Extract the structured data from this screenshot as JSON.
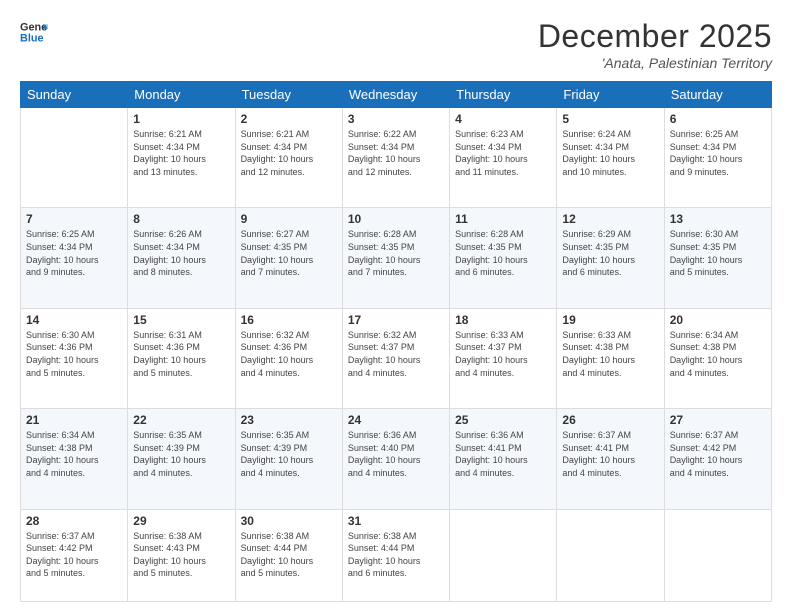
{
  "logo": {
    "line1": "General",
    "line2": "Blue"
  },
  "title": "December 2025",
  "subtitle": "'Anata, Palestinian Territory",
  "days_of_week": [
    "Sunday",
    "Monday",
    "Tuesday",
    "Wednesday",
    "Thursday",
    "Friday",
    "Saturday"
  ],
  "weeks": [
    [
      {
        "num": "",
        "info": ""
      },
      {
        "num": "1",
        "info": "Sunrise: 6:21 AM\nSunset: 4:34 PM\nDaylight: 10 hours\nand 13 minutes."
      },
      {
        "num": "2",
        "info": "Sunrise: 6:21 AM\nSunset: 4:34 PM\nDaylight: 10 hours\nand 12 minutes."
      },
      {
        "num": "3",
        "info": "Sunrise: 6:22 AM\nSunset: 4:34 PM\nDaylight: 10 hours\nand 12 minutes."
      },
      {
        "num": "4",
        "info": "Sunrise: 6:23 AM\nSunset: 4:34 PM\nDaylight: 10 hours\nand 11 minutes."
      },
      {
        "num": "5",
        "info": "Sunrise: 6:24 AM\nSunset: 4:34 PM\nDaylight: 10 hours\nand 10 minutes."
      },
      {
        "num": "6",
        "info": "Sunrise: 6:25 AM\nSunset: 4:34 PM\nDaylight: 10 hours\nand 9 minutes."
      }
    ],
    [
      {
        "num": "7",
        "info": "Sunrise: 6:25 AM\nSunset: 4:34 PM\nDaylight: 10 hours\nand 9 minutes."
      },
      {
        "num": "8",
        "info": "Sunrise: 6:26 AM\nSunset: 4:34 PM\nDaylight: 10 hours\nand 8 minutes."
      },
      {
        "num": "9",
        "info": "Sunrise: 6:27 AM\nSunset: 4:35 PM\nDaylight: 10 hours\nand 7 minutes."
      },
      {
        "num": "10",
        "info": "Sunrise: 6:28 AM\nSunset: 4:35 PM\nDaylight: 10 hours\nand 7 minutes."
      },
      {
        "num": "11",
        "info": "Sunrise: 6:28 AM\nSunset: 4:35 PM\nDaylight: 10 hours\nand 6 minutes."
      },
      {
        "num": "12",
        "info": "Sunrise: 6:29 AM\nSunset: 4:35 PM\nDaylight: 10 hours\nand 6 minutes."
      },
      {
        "num": "13",
        "info": "Sunrise: 6:30 AM\nSunset: 4:35 PM\nDaylight: 10 hours\nand 5 minutes."
      }
    ],
    [
      {
        "num": "14",
        "info": "Sunrise: 6:30 AM\nSunset: 4:36 PM\nDaylight: 10 hours\nand 5 minutes."
      },
      {
        "num": "15",
        "info": "Sunrise: 6:31 AM\nSunset: 4:36 PM\nDaylight: 10 hours\nand 5 minutes."
      },
      {
        "num": "16",
        "info": "Sunrise: 6:32 AM\nSunset: 4:36 PM\nDaylight: 10 hours\nand 4 minutes."
      },
      {
        "num": "17",
        "info": "Sunrise: 6:32 AM\nSunset: 4:37 PM\nDaylight: 10 hours\nand 4 minutes."
      },
      {
        "num": "18",
        "info": "Sunrise: 6:33 AM\nSunset: 4:37 PM\nDaylight: 10 hours\nand 4 minutes."
      },
      {
        "num": "19",
        "info": "Sunrise: 6:33 AM\nSunset: 4:38 PM\nDaylight: 10 hours\nand 4 minutes."
      },
      {
        "num": "20",
        "info": "Sunrise: 6:34 AM\nSunset: 4:38 PM\nDaylight: 10 hours\nand 4 minutes."
      }
    ],
    [
      {
        "num": "21",
        "info": "Sunrise: 6:34 AM\nSunset: 4:38 PM\nDaylight: 10 hours\nand 4 minutes."
      },
      {
        "num": "22",
        "info": "Sunrise: 6:35 AM\nSunset: 4:39 PM\nDaylight: 10 hours\nand 4 minutes."
      },
      {
        "num": "23",
        "info": "Sunrise: 6:35 AM\nSunset: 4:39 PM\nDaylight: 10 hours\nand 4 minutes."
      },
      {
        "num": "24",
        "info": "Sunrise: 6:36 AM\nSunset: 4:40 PM\nDaylight: 10 hours\nand 4 minutes."
      },
      {
        "num": "25",
        "info": "Sunrise: 6:36 AM\nSunset: 4:41 PM\nDaylight: 10 hours\nand 4 minutes."
      },
      {
        "num": "26",
        "info": "Sunrise: 6:37 AM\nSunset: 4:41 PM\nDaylight: 10 hours\nand 4 minutes."
      },
      {
        "num": "27",
        "info": "Sunrise: 6:37 AM\nSunset: 4:42 PM\nDaylight: 10 hours\nand 4 minutes."
      }
    ],
    [
      {
        "num": "28",
        "info": "Sunrise: 6:37 AM\nSunset: 4:42 PM\nDaylight: 10 hours\nand 5 minutes."
      },
      {
        "num": "29",
        "info": "Sunrise: 6:38 AM\nSunset: 4:43 PM\nDaylight: 10 hours\nand 5 minutes."
      },
      {
        "num": "30",
        "info": "Sunrise: 6:38 AM\nSunset: 4:44 PM\nDaylight: 10 hours\nand 5 minutes."
      },
      {
        "num": "31",
        "info": "Sunrise: 6:38 AM\nSunset: 4:44 PM\nDaylight: 10 hours\nand 6 minutes."
      },
      {
        "num": "",
        "info": ""
      },
      {
        "num": "",
        "info": ""
      },
      {
        "num": "",
        "info": ""
      }
    ]
  ]
}
